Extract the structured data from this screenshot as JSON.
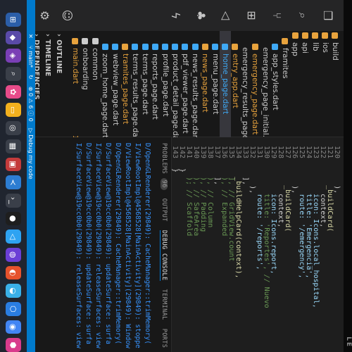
{
  "laptop": {
    "brand": "LE"
  },
  "explorer": {
    "items": [
      {
        "label": "build",
        "color": "#e8a33d",
        "badge": ""
      },
      {
        "label": "ios",
        "color": "#e8a33d",
        "badge": ""
      },
      {
        "label": "lib",
        "color": "#e8a33d",
        "badge": ""
      },
      {
        "label": "api",
        "color": "#e8a33d",
        "badge": ""
      },
      {
        "label": "app",
        "color": "#e8a33d",
        "badge": ""
      },
      {
        "label": "framites",
        "color": "#e8a33d",
        "badge": ""
      },
      {
        "label": "app_styles.dart",
        "color": "#3fa9f5",
        "badge": ""
      },
      {
        "label": "emergency_page_initial.dart",
        "color": "#3fa9f5",
        "badge": ""
      },
      {
        "label": "emergency_page.dart",
        "color": "#e8a33d",
        "badge": "1"
      },
      {
        "label": "emergency_results_page.dart",
        "color": "#3fa9f5",
        "badge": ""
      },
      {
        "label": "entry_app.dart",
        "color": "#e8a33d",
        "badge": "1"
      },
      {
        "label": "home_page.dart",
        "color": "#3fa9f5",
        "badge": "M"
      },
      {
        "label": "menu_page.dart",
        "color": "#3fa9f5",
        "badge": ""
      },
      {
        "label": "news_page.dart",
        "color": "#e8a33d",
        "badge": "2"
      },
      {
        "label": "news_results_page.dart",
        "color": "#3fa9f5",
        "badge": ""
      },
      {
        "label": "pdf_viewer_page.dart",
        "color": "#3fa9f5",
        "badge": ""
      },
      {
        "label": "product_detail_page.dart",
        "color": "#3fa9f5",
        "badge": ""
      },
      {
        "label": "profile_page.dart",
        "color": "#3fa9f5",
        "badge": ""
      },
      {
        "label": "reports_page.dart",
        "color": "#3fa9f5",
        "badge": ""
      },
      {
        "label": "terms_page.dart",
        "color": "#3fa9f5",
        "badge": ""
      },
      {
        "label": "terms_results_page.dart",
        "color": "#3fa9f5",
        "badge": ""
      },
      {
        "label": "tramites_page.dart",
        "color": "#e8a33d",
        "badge": "1"
      },
      {
        "label": "webview_page.dart",
        "color": "#3fa9f5",
        "badge": ""
      },
      {
        "label": "zoom_home_page.dart",
        "color": "#3fa9f5",
        "badge": ""
      },
      {
        "label": "common",
        "color": "#cccccc",
        "badge": ""
      },
      {
        "label": "onboarding",
        "color": "#cccccc",
        "badge": ""
      },
      {
        "label": "main.dart",
        "color": "#e8a33d",
        "badge": "1"
      }
    ],
    "outline": "OUTLINE",
    "timeline": "TIMELINE",
    "dependencies": "DEPENDENCIES"
  },
  "editor": {
    "lines": [
      {
        "n": "120",
        "t": "    ),"
      },
      {
        "n": "121",
        "t": "    _buildCard("
      },
      {
        "n": "122",
        "t": "      context,"
      },
      {
        "n": "123",
        "t": "      icon: Icons.local_hospital,"
      },
      {
        "n": "124",
        "t": "      title: 'Emergencia',"
      },
      {
        "n": "125",
        "t": "      route: '/emergency',"
      },
      {
        "n": "126",
        "t": "    ),"
      },
      {
        "n": "127",
        "t": "    _buildCard("
      },
      {
        "n": "128",
        "t": "      context,"
      },
      {
        "n": "129",
        "t": "      icon: Icons.report,"
      },
      {
        "n": "130",
        "t": "      title: 'Reportes', // Nuevo"
      },
      {
        "n": "131",
        "t": "      route: '/reports',"
      },
      {
        "n": "132",
        "t": "    ),"
      },
      {
        "n": "133",
        "t": "  ],"
      },
      {
        "n": "134",
        "t": "  _buildHelpCard(context),"
      },
      {
        "n": "135",
        "t": "  ], // GridView.count"
      },
      {
        "n": "136",
        "t": "  ), // Expanded"
      },
      {
        "n": "137",
        "t": "  ],"
      },
      {
        "n": "138",
        "t": "  ), // Column"
      },
      {
        "n": "139",
        "t": "  ), // Padding"
      },
      {
        "n": "140",
        "t": "  ), // SafeArea"
      },
      {
        "n": "141",
        "t": "  ); // Scaffold"
      },
      {
        "n": "142",
        "t": "}"
      },
      {
        "n": "143",
        "t": "}"
      }
    ]
  },
  "panel": {
    "tabs": [
      "PROBLEMS",
      "OUTPUT",
      "DEBUG CONSOLE",
      "TERMINAL",
      "PORTS"
    ],
    "problems_count": "96",
    "logs": [
      "D/OpenGLRenderer(29849): CacheManager::trimMemory(",
      "I/ViewRootImpl@4568528[MainActivity](29849): stoppe",
      "D/ViewRootImpl@4568528[MainActivity](29849): Window",
      "D/OpenGLRenderer(29849): CacheManager::trimMemory(",
      "D/SurfaceView@19cc0b0(29849): updateSurface: surfa",
      "I/SurfaceView@19cc0b0(29849): releaseSurfaces: view",
      "D/SurfaceView@19cc0b0(29849): updateSurface: surfa",
      "I/SurfaceView@19cc0b0(29849): releaseSurfaces: view"
    ]
  },
  "status": {
    "branch": "main*",
    "sync": "↻",
    "errors": "0",
    "warnings": "6",
    "infos": "0",
    "debug": "Debug my code"
  }
}
